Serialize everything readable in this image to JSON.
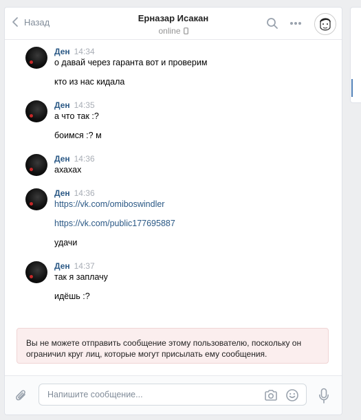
{
  "header": {
    "back_label": "Назад",
    "title": "Ерназар Исакан",
    "status": "online"
  },
  "messages": [
    {
      "author": "Ден",
      "time": "14:34",
      "lines": [
        {
          "text": "о давай через гаранта вот и проверим",
          "link": false
        },
        {
          "text": "кто из нас кидала",
          "link": false
        }
      ]
    },
    {
      "author": "Ден",
      "time": "14:35",
      "lines": [
        {
          "text": "а что так :?",
          "link": false
        },
        {
          "text": "боимся :? м",
          "link": false
        }
      ]
    },
    {
      "author": "Ден",
      "time": "14:36",
      "lines": [
        {
          "text": "ахахах",
          "link": false
        }
      ]
    },
    {
      "author": "Ден",
      "time": "14:36",
      "lines": [
        {
          "text": "https://vk.com/omiboswindler",
          "link": true
        },
        {
          "text": "https://vk.com/public177695887",
          "link": true
        },
        {
          "text": "удачи",
          "link": false
        }
      ]
    },
    {
      "author": "Ден",
      "time": "14:37",
      "lines": [
        {
          "text": "так я заплачу",
          "link": false
        },
        {
          "text": "идёшь :?",
          "link": false
        }
      ]
    }
  ],
  "warning": "Вы не можете отправить сообщение этому пользователю, поскольку он ограничил круг лиц, которые могут присылать ему сообщения.",
  "composer": {
    "placeholder": "Напишите сообщение...",
    "value": ""
  },
  "colors": {
    "accent": "#2a5885",
    "warning_bg": "#fbeeee",
    "muted": "#818c99"
  }
}
